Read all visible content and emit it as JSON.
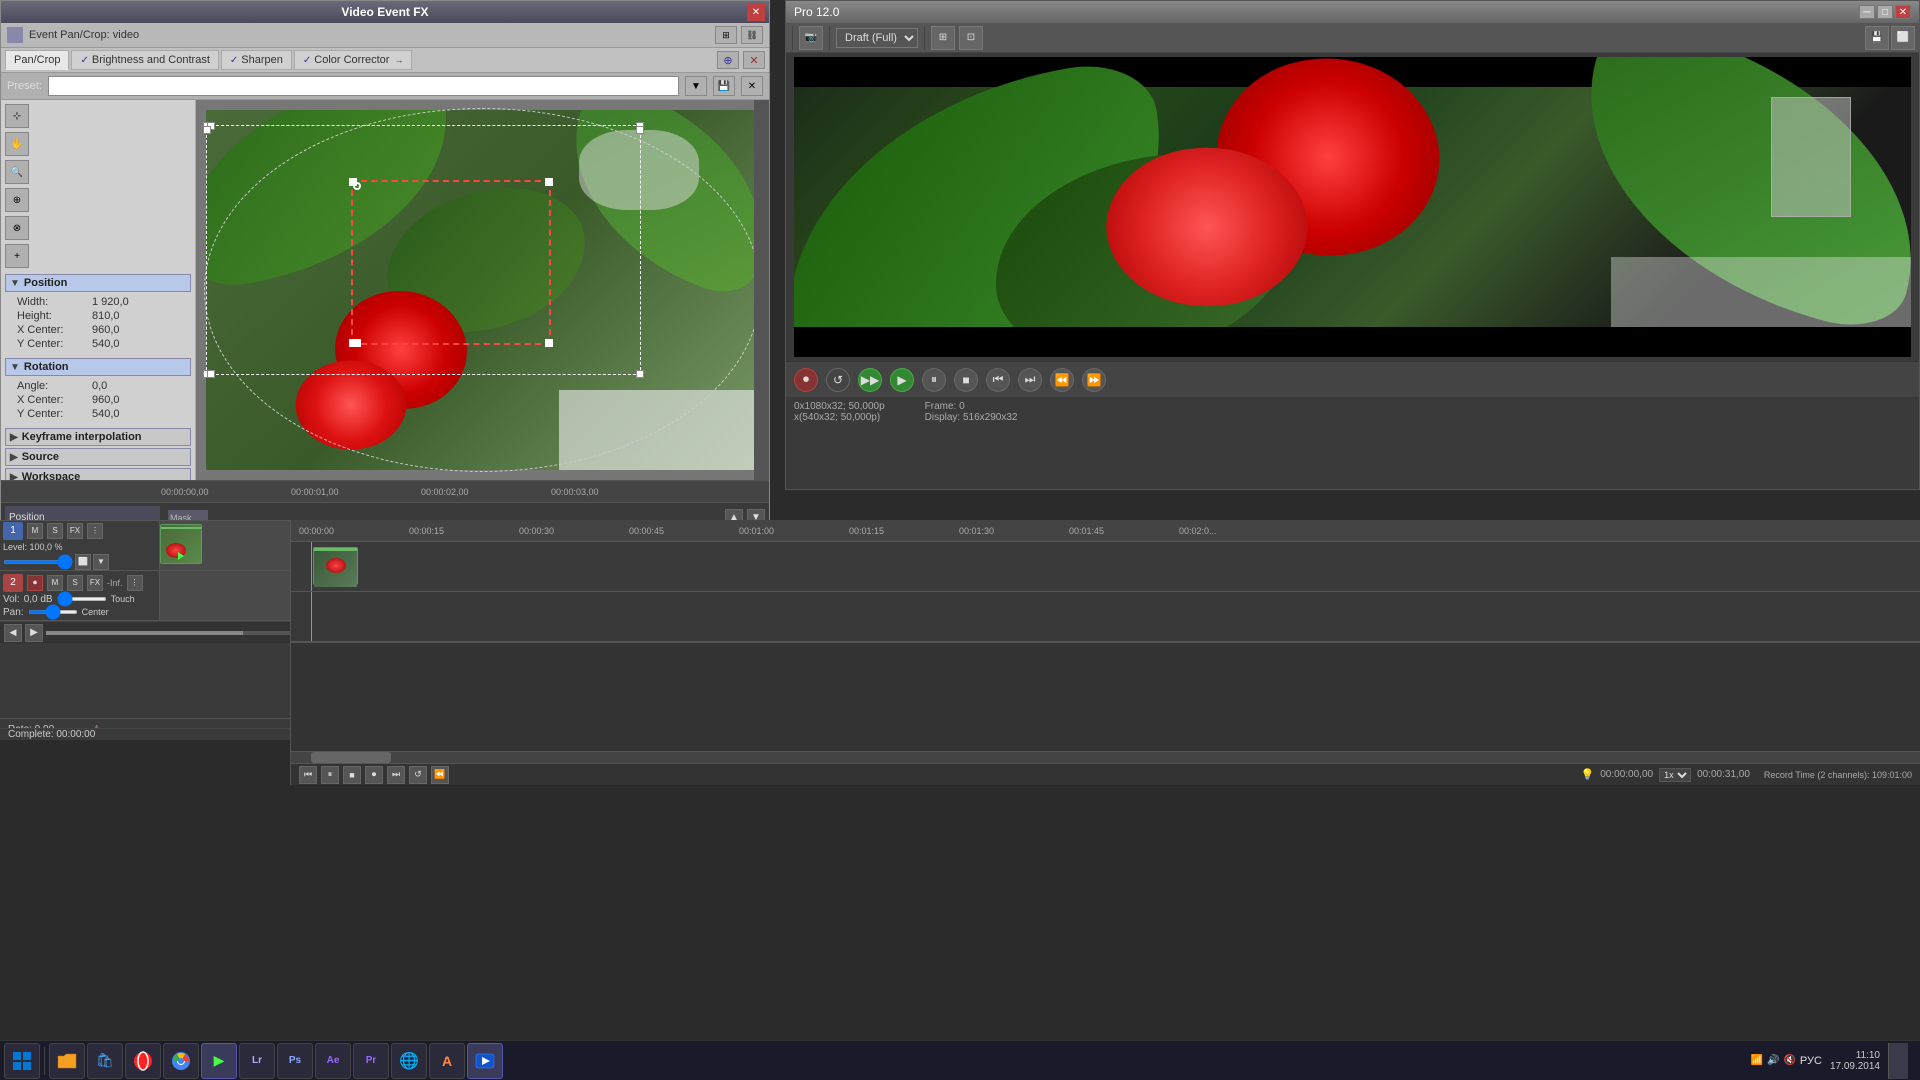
{
  "fx_window": {
    "title": "Video Event FX",
    "event_label": "Event Pan/Crop:  video",
    "tabs": [
      {
        "id": "pan-crop",
        "label": "Pan/Crop",
        "active": true,
        "checked": false
      },
      {
        "id": "brightness",
        "label": "Brightness and Contrast",
        "active": false,
        "checked": true
      },
      {
        "id": "sharpen",
        "label": "Sharpen",
        "active": false,
        "checked": true
      },
      {
        "id": "color-corrector",
        "label": "Color Corrector",
        "active": false,
        "checked": true
      }
    ],
    "preset_label": "Preset:",
    "sections": {
      "position": {
        "title": "Position",
        "expanded": true,
        "props": [
          {
            "label": "Width:",
            "value": "1 920,0"
          },
          {
            "label": "Height:",
            "value": "810,0"
          },
          {
            "label": "X Center:",
            "value": "960,0"
          },
          {
            "label": "Y Center:",
            "value": "540,0"
          }
        ]
      },
      "rotation": {
        "title": "Rotation",
        "expanded": true,
        "props": [
          {
            "label": "Angle:",
            "value": "0,0"
          },
          {
            "label": "X Center:",
            "value": "960,0"
          },
          {
            "label": "Y Center:",
            "value": "540,0"
          }
        ]
      },
      "keyframe": {
        "title": "Keyframe interpolation",
        "expanded": false
      },
      "source": {
        "title": "Source",
        "expanded": false
      },
      "workspace": {
        "title": "Workspace",
        "expanded": false
      }
    }
  },
  "pro_window": {
    "title": "Pro 12.0",
    "draft_mode": "Draft (Full)"
  },
  "timeline_fx": {
    "timestamps": [
      "00:00:00,00",
      "00:00:01,00",
      "00:00:02,00",
      "00:00:03,00"
    ],
    "current_time": "00:00:00,00"
  },
  "tracks": {
    "video_track": {
      "number": "1",
      "level_label": "Level: 100,0 %"
    },
    "audio_track": {
      "number": "2",
      "vol_label": "Vol:",
      "vol_value": "0,0 dB",
      "vol_mode": "Touch",
      "pan_label": "Pan:",
      "pan_value": "Center"
    }
  },
  "main_timeline": {
    "ruler_marks": [
      "00:00:00",
      "00:00:15",
      "00:00:30",
      "00:00:45",
      "00:01:00",
      "00:01:15",
      "00:01:30",
      "00:01:45",
      "00:02:0..."
    ],
    "record_time": "Record Time (2 channels): 109:01:00"
  },
  "status": {
    "rate": "Rate: 0,00",
    "complete": "Complete: 00:00:00",
    "frame_info": "0x1080x32; 50,000p",
    "source_info": "x(540x32; 50,000p)",
    "frame_label": "Frame:",
    "frame_value": "0",
    "display_label": "Display:",
    "display_value": "516x290x32"
  },
  "playback_time": "00:00:00,00",
  "record_time_display": "00:00:31,00",
  "taskbar": {
    "time": "11:10",
    "date": "17.09.2014",
    "layout": "РУС"
  },
  "icons": {
    "close": "✕",
    "minimize": "─",
    "maximize": "□",
    "play": "▶",
    "pause": "⏸",
    "stop": "■",
    "record": "⏺",
    "rewind": "⏮",
    "fast_forward": "⏭",
    "step_back": "⏪",
    "step_forward": "⏩",
    "loop": "↺",
    "arrow_left": "◀",
    "arrow_right": "▶"
  }
}
